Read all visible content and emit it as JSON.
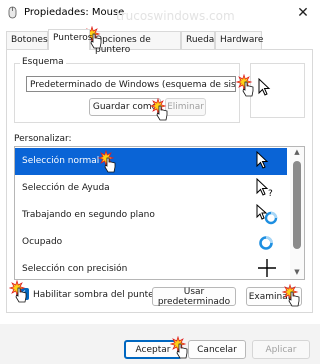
{
  "window": {
    "title": "Propiedades: Mouse",
    "close_glyph": "✕"
  },
  "watermark": "trucoswindows.com",
  "tabs": [
    {
      "label": "Botones"
    },
    {
      "label": "Punteros"
    },
    {
      "label": "Opciones de puntero"
    },
    {
      "label": "Rueda"
    },
    {
      "label": "Hardware"
    }
  ],
  "scheme": {
    "group_label": "Esquema",
    "value": "Predeterminado de Windows (esquema de siste",
    "save_as_label": "Guardar como",
    "delete_label": "Eliminar"
  },
  "customize": {
    "label": "Personalizar:",
    "items": [
      {
        "label": "Selección normal",
        "icon": "arrow-pointer-icon"
      },
      {
        "label": "Selección de Ayuda",
        "icon": "help-pointer-icon"
      },
      {
        "label": "Trabajando en segundo plano",
        "icon": "working-pointer-icon"
      },
      {
        "label": "Ocupado",
        "icon": "busy-pointer-icon"
      },
      {
        "label": "Selección con precisión",
        "icon": "crosshair-pointer-icon"
      }
    ]
  },
  "shadow_checkbox": {
    "label": "Habilitar sombra del puntero",
    "checked": true,
    "check_glyph": "✓"
  },
  "use_default_label": "Usar predeterminado",
  "browse_label": "Examinar...",
  "footer": {
    "accept": "Aceptar",
    "cancel": "Cancelar",
    "apply": "Aplicar"
  },
  "scrollbar": {
    "up_glyph": "▲",
    "down_glyph": "▼"
  },
  "colors": {
    "accent": "#0067c0",
    "selection": "#0a64d6",
    "click_marker": "#ffd21a",
    "click_marker_edge": "#e02020"
  }
}
